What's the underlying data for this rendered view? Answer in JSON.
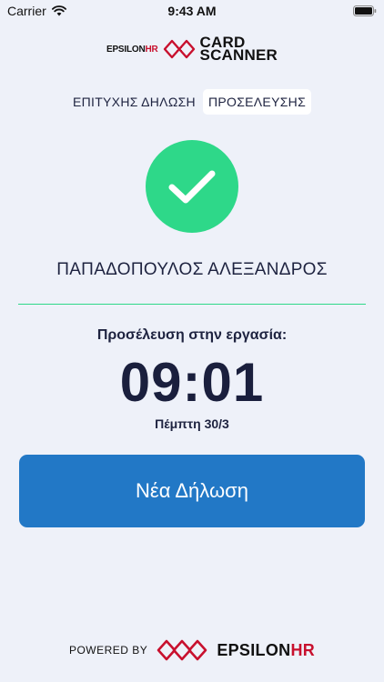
{
  "status_bar": {
    "carrier": "Carrier",
    "time": "9:43 AM",
    "icons": {
      "wifi": "wifi-icon",
      "battery": "battery-icon"
    }
  },
  "app_logo": {
    "brand_prefix": "EPSILON",
    "brand_suffix": "HR",
    "card_word": "CARD",
    "scanner_word": "SCANNER"
  },
  "status_line": {
    "text": "ΕΠΙΤΥΧΗΣ ΔΗΛΩΣΗ",
    "highlight": "ΠΡΟΣΕΛΕΥΣΗΣ"
  },
  "employee_name": "ΠΑΠΑΔΟΠΟΥΛΟΣ ΑΛΕΞΑΝΔΡΟΣ",
  "arrival": {
    "label": "Προσέλευση στην εργασία:",
    "time": "09:01",
    "date": "Πέμπτη 30/3"
  },
  "new_declaration_button": "Νέα Δήλωση",
  "footer": {
    "powered_by": "POWERED BY",
    "brand_prefix": "EPSILON",
    "brand_suffix": "HR"
  },
  "colors": {
    "background": "#eef1f9",
    "success": "#2ed889",
    "primary": "#2278c6",
    "brand_red": "#c8102e",
    "text": "#1e2340"
  }
}
